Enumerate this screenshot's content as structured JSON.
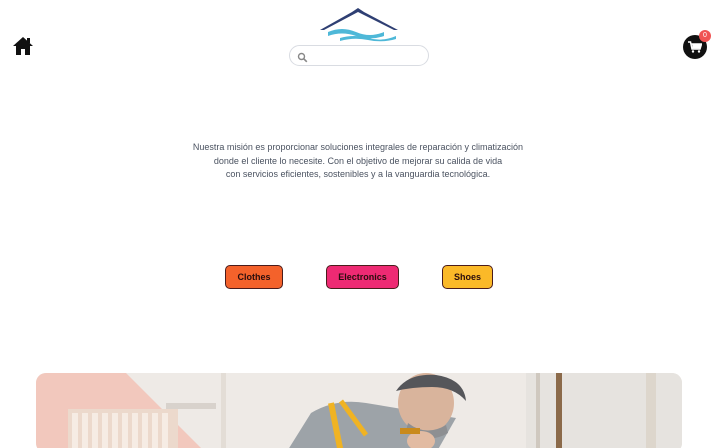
{
  "header": {
    "search": {
      "placeholder": "",
      "value": ""
    },
    "cart": {
      "count": "0"
    }
  },
  "mission": {
    "lines": [
      "Nuestra misión es proporcionar soluciones integrales de reparación y climatización",
      "donde el cliente lo necesite. Con el objetivo de mejorar su calida de vida",
      "con servicios eficientes, sostenibles y a la vanguardia tecnológica."
    ]
  },
  "categories": [
    {
      "label": "Clothes",
      "color": "#f4622b"
    },
    {
      "label": "Electronics",
      "color": "#ee2a73"
    },
    {
      "label": "Shoes",
      "color": "#fbb928"
    }
  ],
  "colors": {
    "logo_dark": "#2f3f73",
    "logo_light": "#4eb8d8",
    "badge": "#f05454",
    "text": "#4a5260"
  },
  "icons": {
    "home": "home-icon",
    "search": "search-icon",
    "cart": "cart-icon"
  }
}
